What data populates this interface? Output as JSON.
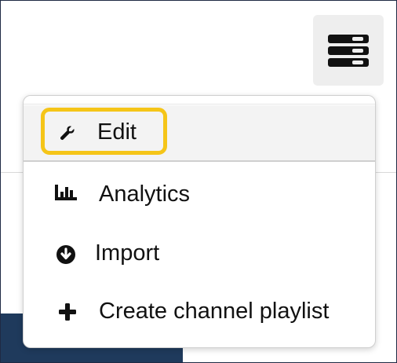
{
  "menu": {
    "items": [
      {
        "label": "Edit",
        "icon": "wrench-icon",
        "highlighted": true
      },
      {
        "label": "Analytics",
        "icon": "bar-chart-icon"
      },
      {
        "label": "Import",
        "icon": "circle-arrow-down-icon"
      },
      {
        "label": "Create channel playlist",
        "icon": "plus-icon"
      }
    ]
  },
  "colors": {
    "highlight": "#f5c518",
    "text": "#111111",
    "toggle_bg": "#eeeeee",
    "navy": "#1f3a5c"
  }
}
